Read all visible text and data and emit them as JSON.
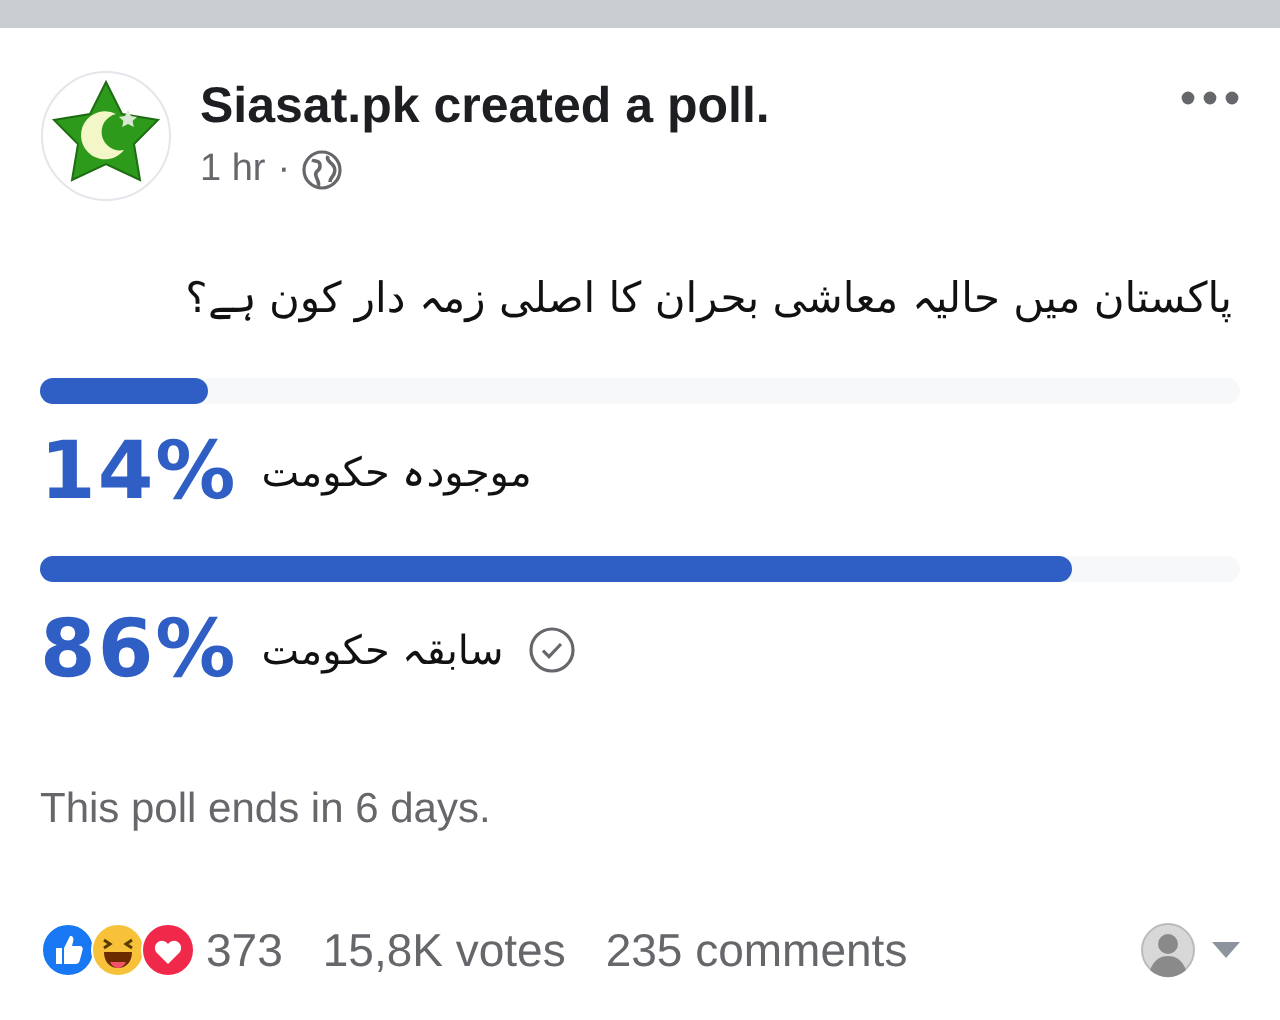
{
  "post": {
    "author": "Siasat.pk",
    "action": "created a poll.",
    "time": "1 hr",
    "separator": "·",
    "question": "پاکستان میں حالیہ معاشی بحران کا اصلی زمہ دار کون ہے؟"
  },
  "options": [
    {
      "percent": "14%",
      "label": "موجودہ حکومت",
      "level": 0.14,
      "voted": false
    },
    {
      "percent": "86%",
      "label": "سابقہ حکومت",
      "level": 0.86,
      "voted": true
    }
  ],
  "poll_status": "This poll ends in 6 days.",
  "footer": {
    "reactions_count": "373",
    "votes": "15,8K votes",
    "comments": "235 comments"
  }
}
